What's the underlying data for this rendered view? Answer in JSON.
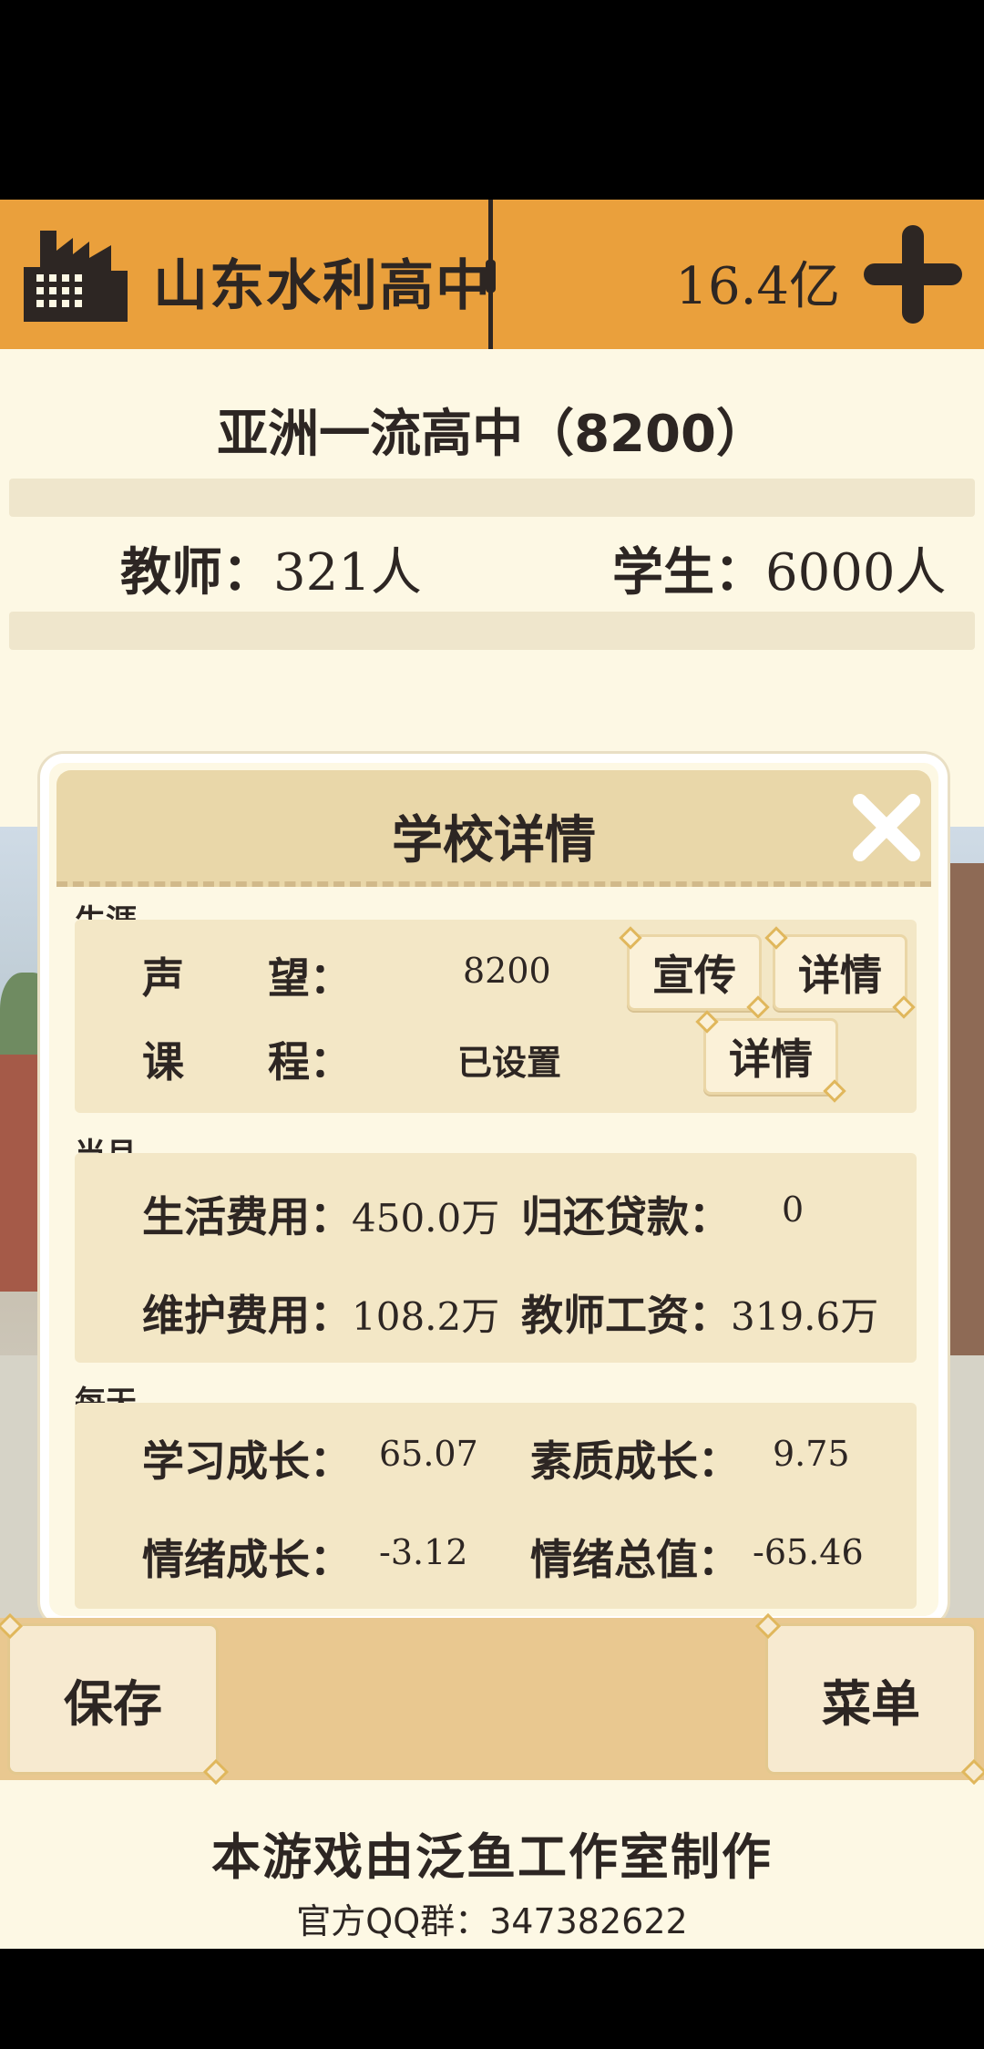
{
  "header": {
    "school_name": "山东水利高中",
    "money": "16.4亿",
    "factory_icon": "factory-icon",
    "plus_icon": "plus-icon"
  },
  "summary": {
    "rank_title": "亚洲一流高中（8200）",
    "teacher_label": "教师：",
    "teacher_value": "321人",
    "student_label": "学生：",
    "student_value": "6000人"
  },
  "popup": {
    "title": "学校详情",
    "close_icon": "close-icon",
    "career": {
      "label": "生涯",
      "reputation_label": "声　　望：",
      "reputation_value": "8200",
      "promote_button": "宣传",
      "reputation_detail_button": "详情",
      "course_label": "课　　程：",
      "course_value": "已设置",
      "course_detail_button": "详情"
    },
    "monthly": {
      "label": "当月",
      "living_label": "生活费用：",
      "living_value": "450.0万",
      "loan_label": "归还贷款：",
      "loan_value": "0",
      "maintenance_label": "维护费用：",
      "maintenance_value": "108.2万",
      "salary_label": "教师工资：",
      "salary_value": "319.6万"
    },
    "daily": {
      "label": "每天",
      "study_label": "学习成长：",
      "study_value": "65.07",
      "quality_label": "素质成长：",
      "quality_value": "9.75",
      "mood_label": "情绪成长：",
      "mood_value": "-3.12",
      "mood_total_label": "情绪总值：",
      "mood_total_value": "-65.46"
    }
  },
  "bottom": {
    "save_button": "保存",
    "menu_button": "菜单"
  },
  "footer": {
    "credit": "本游戏由泛鱼工作室制作",
    "qq_group": "官方QQ群：347382622"
  },
  "colors": {
    "header_bg": "#eaa03c",
    "page_bg": "#fdf8e4",
    "panel_bg": "#f3e7c6",
    "text_dark": "#2d2623"
  }
}
